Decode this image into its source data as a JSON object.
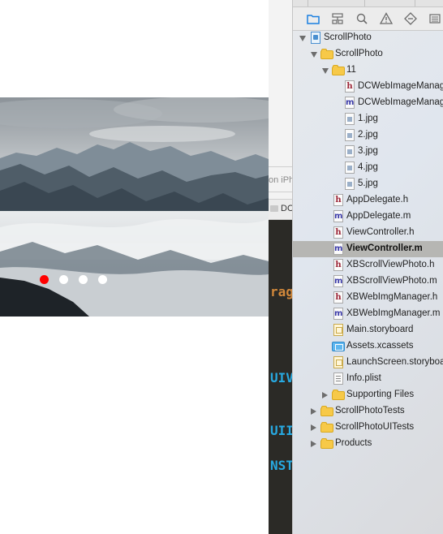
{
  "simulator": {
    "page_dots": {
      "count": 4,
      "active_index": 0
    },
    "colors": {
      "active_dot": "#ff0000",
      "inactive_dot": "#ffffff"
    }
  },
  "editor": {
    "device_label": "on iPh",
    "jump_bar_label": "DC",
    "code_fragments": [
      "rage",
      "UIV",
      "UII",
      "NST"
    ]
  },
  "navigator": {
    "tab_icons": [
      "folder-icon",
      "hierarchy-icon",
      "search-icon",
      "warning-icon",
      "breakpoint-icon",
      "list-icon"
    ],
    "tree": [
      {
        "label": "ScrollPhoto",
        "icon": "project-icon",
        "disclosure": "open",
        "depth": 0
      },
      {
        "label": "ScrollPhoto",
        "icon": "folder-icon",
        "disclosure": "open",
        "depth": 1
      },
      {
        "label": "11",
        "icon": "folder-icon",
        "disclosure": "open",
        "depth": 2
      },
      {
        "label": "DCWebImageManager.h",
        "icon": "header-file-icon",
        "disclosure": "none",
        "depth": 3
      },
      {
        "label": "DCWebImageManager.m",
        "icon": "source-file-icon",
        "disclosure": "none",
        "depth": 3
      },
      {
        "label": "1.jpg",
        "icon": "image-file-icon",
        "disclosure": "none",
        "depth": 3
      },
      {
        "label": "2.jpg",
        "icon": "image-file-icon",
        "disclosure": "none",
        "depth": 3
      },
      {
        "label": "3.jpg",
        "icon": "image-file-icon",
        "disclosure": "none",
        "depth": 3
      },
      {
        "label": "4.jpg",
        "icon": "image-file-icon",
        "disclosure": "none",
        "depth": 3
      },
      {
        "label": "5.jpg",
        "icon": "image-file-icon",
        "disclosure": "none",
        "depth": 3
      },
      {
        "label": "AppDelegate.h",
        "icon": "header-file-icon",
        "disclosure": "none",
        "depth": 2
      },
      {
        "label": "AppDelegate.m",
        "icon": "source-file-icon",
        "disclosure": "none",
        "depth": 2
      },
      {
        "label": "ViewController.h",
        "icon": "header-file-icon",
        "disclosure": "none",
        "depth": 2
      },
      {
        "label": "ViewController.m",
        "icon": "source-file-icon",
        "disclosure": "none",
        "depth": 2,
        "selected": true
      },
      {
        "label": "XBScrollViewPhoto.h",
        "icon": "header-file-icon",
        "disclosure": "none",
        "depth": 2
      },
      {
        "label": "XBScrollViewPhoto.m",
        "icon": "source-file-icon",
        "disclosure": "none",
        "depth": 2
      },
      {
        "label": "XBWebImgManager.h",
        "icon": "header-file-icon",
        "disclosure": "none",
        "depth": 2
      },
      {
        "label": "XBWebImgManager.m",
        "icon": "source-file-icon",
        "disclosure": "none",
        "depth": 2
      },
      {
        "label": "Main.storyboard",
        "icon": "storyboard-file-icon",
        "disclosure": "none",
        "depth": 2
      },
      {
        "label": "Assets.xcassets",
        "icon": "asset-catalog-icon",
        "disclosure": "none",
        "depth": 2
      },
      {
        "label": "LaunchScreen.storyboard",
        "icon": "storyboard-file-icon",
        "disclosure": "none",
        "depth": 2
      },
      {
        "label": "Info.plist",
        "icon": "plist-file-icon",
        "disclosure": "none",
        "depth": 2
      },
      {
        "label": "Supporting Files",
        "icon": "folder-icon",
        "disclosure": "closed",
        "depth": 2
      },
      {
        "label": "ScrollPhotoTests",
        "icon": "folder-icon",
        "disclosure": "closed",
        "depth": 1
      },
      {
        "label": "ScrollPhotoUITests",
        "icon": "folder-icon",
        "disclosure": "closed",
        "depth": 1
      },
      {
        "label": "Products",
        "icon": "folder-icon",
        "disclosure": "closed",
        "depth": 1
      }
    ]
  }
}
